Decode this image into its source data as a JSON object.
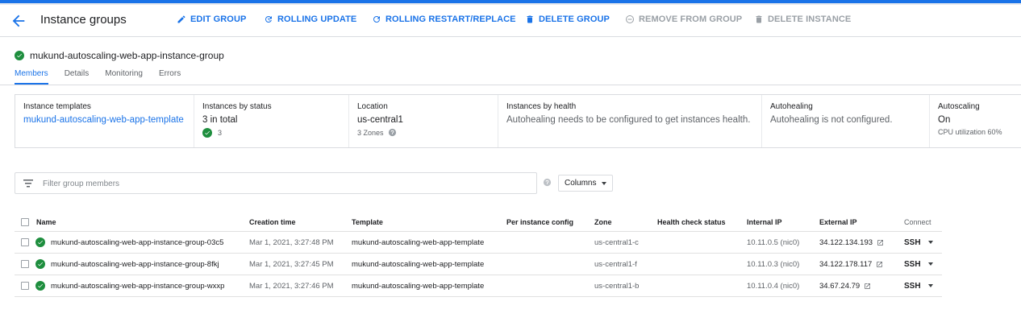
{
  "header": {
    "title": "Instance groups",
    "actions": [
      {
        "label": "EDIT GROUP",
        "icon": "pencil-icon",
        "enabled": true
      },
      {
        "label": "ROLLING UPDATE",
        "icon": "rolling-update-icon",
        "enabled": true
      },
      {
        "label": "ROLLING RESTART/REPLACE",
        "icon": "restart-icon",
        "enabled": true
      },
      {
        "label": "DELETE GROUP",
        "icon": "trash-icon",
        "enabled": true
      },
      {
        "label": "REMOVE FROM GROUP",
        "icon": "remove-circle-icon",
        "enabled": false
      },
      {
        "label": "DELETE INSTANCE",
        "icon": "trash-icon",
        "enabled": false
      }
    ]
  },
  "group": {
    "name": "mukund-autoscaling-web-app-instance-group",
    "status_icon": "check-circle-icon"
  },
  "tabs": [
    "Members",
    "Details",
    "Monitoring",
    "Errors"
  ],
  "active_tab": "Members",
  "summary": {
    "templates": {
      "label": "Instance templates",
      "value": "mukund-autoscaling-web-app-template"
    },
    "status": {
      "label": "Instances by status",
      "value": "3 in total",
      "ok_count": "3"
    },
    "location": {
      "label": "Location",
      "value": "us-central1",
      "sub": "3 Zones"
    },
    "health": {
      "label": "Instances by health",
      "value": "Autohealing needs to be configured to get instances health."
    },
    "autohealing": {
      "label": "Autohealing",
      "value": "Autohealing is not configured."
    },
    "autoscaling": {
      "label": "Autoscaling",
      "value": "On",
      "sub": "CPU utilization 60%"
    }
  },
  "filter": {
    "placeholder": "Filter group members"
  },
  "columns_button": "Columns",
  "table": {
    "headers": {
      "name": "Name",
      "creation": "Creation time",
      "template": "Template",
      "config": "Per instance config",
      "zone": "Zone",
      "health": "Health check status",
      "internal_ip": "Internal IP",
      "external_ip": "External IP",
      "connect": "Connect"
    },
    "rows": [
      {
        "name": "mukund-autoscaling-web-app-instance-group-03c5",
        "creation": "Mar 1, 2021, 3:27:48 PM",
        "template": "mukund-autoscaling-web-app-template",
        "zone": "us-central1-c",
        "internal_ip": "10.11.0.5 (nic0)",
        "external_ip": "34.122.134.193",
        "connect": "SSH"
      },
      {
        "name": "mukund-autoscaling-web-app-instance-group-8fkj",
        "creation": "Mar 1, 2021, 3:27:45 PM",
        "template": "mukund-autoscaling-web-app-template",
        "zone": "us-central1-f",
        "internal_ip": "10.11.0.3 (nic0)",
        "external_ip": "34.122.178.117",
        "connect": "SSH"
      },
      {
        "name": "mukund-autoscaling-web-app-instance-group-wxxp",
        "creation": "Mar 1, 2021, 3:27:46 PM",
        "template": "mukund-autoscaling-web-app-template",
        "zone": "us-central1-b",
        "internal_ip": "10.11.0.4 (nic0)",
        "external_ip": "34.67.24.79",
        "connect": "SSH"
      }
    ]
  },
  "colors": {
    "accent": "#1a73e8",
    "success": "#1e8e3e",
    "disabled": "#9aa0a6"
  }
}
